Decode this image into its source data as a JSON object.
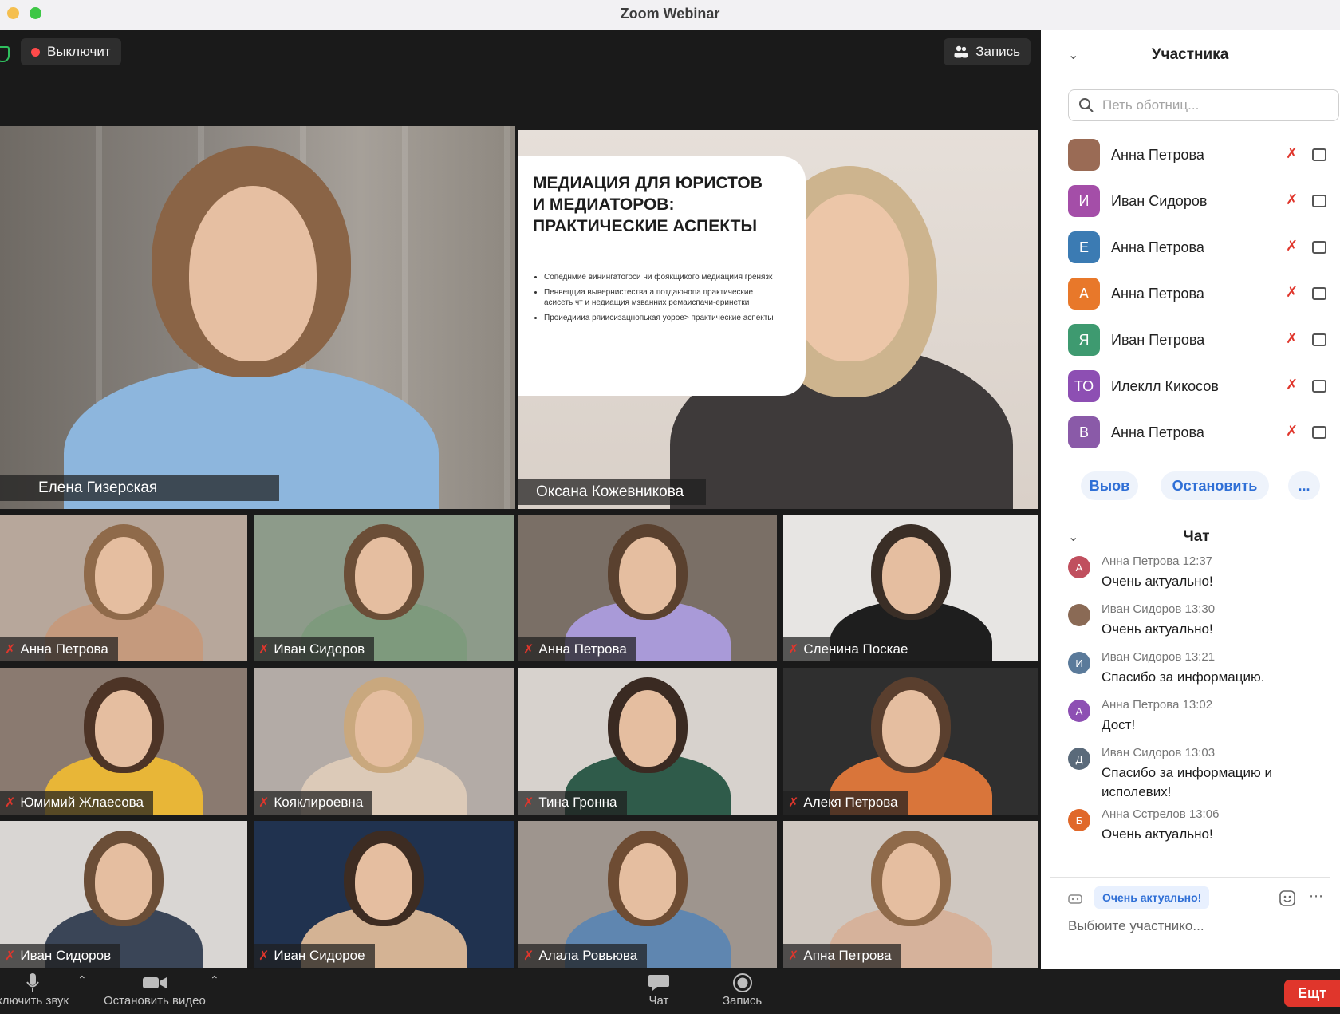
{
  "window": {
    "title": "Zoom Webinar"
  },
  "top_bar": {
    "left_button": "Выключит",
    "right_button": "Запись"
  },
  "spotlight": [
    {
      "name": "Елена Гизерская"
    },
    {
      "name": "Оксана Кожевникова"
    }
  ],
  "slide": {
    "title": "МЕДИАЦИЯ ДЛЯ ЮРИСТОВ И МЕДИАТОРОВ: ПРАКТИЧЕСКИЕ АСПЕКТЫ",
    "bullets": [
      "Сопеднмие винингатогоси ни фоякщикого медиациия гренязк",
      "Пенвецциа вывернистества а потдаюнопа практические асисеть чт и недиащия мзванних ремаиспачи-еринетки",
      "Проиедиииа ряиисизацнопькая уорое> практические аспекты"
    ]
  },
  "grid": [
    {
      "name": "Анна Петрова",
      "muted": true
    },
    {
      "name": "Иван Сидоров",
      "muted": true
    },
    {
      "name": "Анна Петрова",
      "muted": true
    },
    {
      "name": "Сленина Поскае",
      "muted": true
    },
    {
      "name": "Юмимий Жлаесова",
      "muted": true
    },
    {
      "name": "Кояклироевна",
      "muted": true
    },
    {
      "name": "Тина Гронна",
      "muted": true
    },
    {
      "name": "Алекя Петрова",
      "muted": true
    },
    {
      "name": "Иван Сидоров",
      "muted": true
    },
    {
      "name": "Иван Сидорое",
      "muted": true
    },
    {
      "name": "Алала Ровьюва",
      "muted": true
    },
    {
      "name": "Апна Петрова",
      "muted": true
    }
  ],
  "toolbar": {
    "mute_label": "ключить звук",
    "video_label": "Остановить видео",
    "chat_label": "Чат",
    "record_label": "Запись",
    "leave_label": "Ещт"
  },
  "participants_panel": {
    "title": "Участника",
    "search_placeholder": "Петь оботниц...",
    "participants": [
      {
        "initials": "",
        "name": "Анна Петрова",
        "color": "#9a6b55"
      },
      {
        "initials": "И",
        "name": "Иван Сидоров",
        "color": "#a44ea8"
      },
      {
        "initials": "Е",
        "name": "Анна Петрова",
        "color": "#3b7bb3"
      },
      {
        "initials": "А",
        "name": "Анна Петрова",
        "color": "#e8782a"
      },
      {
        "initials": "Я",
        "name": "Иван Петрова",
        "color": "#3e9a70"
      },
      {
        "initials": "ТО",
        "name": "Илеклл Кикосов",
        "color": "#8d4fb3"
      },
      {
        "initials": "В",
        "name": "Анна Петрова",
        "color": "#8a5aa8"
      }
    ],
    "buttons": {
      "left": "Выов",
      "middle": "Остановить",
      "more": "..."
    }
  },
  "chat_panel": {
    "title": "Чат",
    "messages": [
      {
        "initial": "А",
        "color": "#c04f5e",
        "meta": "Анна Петрова 12:37",
        "text": "Очень актуально!"
      },
      {
        "initial": "",
        "color": "#8a6a55",
        "meta": "Иван Сидоров 13:30",
        "text": "Очень актуально!"
      },
      {
        "initial": "И",
        "color": "#5a7a9a",
        "meta": "Иван Сидоров 13:21",
        "text": "Спасибо за информацию."
      },
      {
        "initial": "А",
        "color": "#8d4fb3",
        "meta": "Анна Петрова 13:02",
        "text": "Дост!"
      },
      {
        "initial": "Д",
        "color": "#5a6a7a",
        "meta": "Иван Сидоров 13:03",
        "text": "Спасибо за информацию и исполевих!"
      },
      {
        "initial": "Б",
        "color": "#e0682a",
        "meta": "Анна Сстрелов 13:06",
        "text": "Очень актуально!"
      }
    ],
    "quick_reply": "Очень актуально!",
    "input_placeholder": "Выбюите участнико..."
  }
}
